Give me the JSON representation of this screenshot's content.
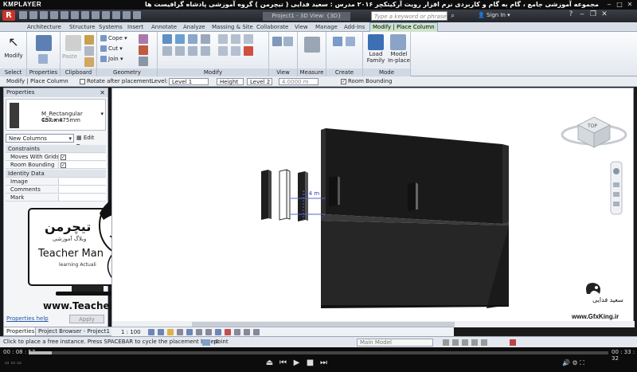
{
  "player": {
    "logo": "KMPLAYER",
    "title": "مجموعه آموزشی جامع ، گام به گام و کاربردی نرم افزار رویت آرکیتکچر ۲۰۱۶ مدرس : سعید فدایی ( تیچرمن ) گروه آموزشی پادشاه گرافیست ها",
    "time_current": "00 : 08 : 57",
    "time_total": "00 : 33 : 32",
    "progress": 0.04
  },
  "app": {
    "logo": "R",
    "doc_title": "Project1 - 3D View: {3D}",
    "search_placeholder": "Type a keyword or phrase",
    "sign_in": "Sign In"
  },
  "tabs": [
    "Architecture",
    "Structure",
    "Systems",
    "Insert",
    "Annotate",
    "Analyze",
    "Massing & Site",
    "Collaborate",
    "View",
    "Manage",
    "Add-Ins",
    "Modify | Place Column"
  ],
  "ribbon": {
    "modify": "Modify",
    "select_label": "Select",
    "properties_label": "Properties",
    "clipboard_label": "Clipboard",
    "paste": "Paste",
    "geometry_label": "Geometry",
    "cope": "Cope",
    "cut": "Cut",
    "join": "Join",
    "modify_label": "Modify",
    "view_label": "View",
    "measure_label": "Measure",
    "create_label": "Create",
    "mode_label": "Mode",
    "load_family": "Load Family",
    "model_inplace": "Model In-place"
  },
  "optbar": {
    "context": "Modify | Place Column",
    "rotate_after": "Rotate after placement",
    "level_label": "Level:",
    "level_value": "Level 1",
    "height_value": "Height",
    "height_level": "Level 2",
    "height_offset": "4.0000 m",
    "room_bounding": "Room Bounding"
  },
  "properties": {
    "header": "Properties",
    "type_name": "M_Rectangular Column",
    "type_dim": "457 x 475mm",
    "instance_selector": "New Columns",
    "edit_type": "Edit Type",
    "groups": [
      {
        "name": "Constraints",
        "rows": [
          "Moves With Grids",
          "Room Bounding"
        ]
      },
      {
        "name": "Identity Data",
        "rows": [
          "Image",
          "Comments",
          "Mark"
        ]
      }
    ],
    "help": "Properties help",
    "apply": "Apply",
    "tab_properties": "Properties",
    "tab_browser": "Project Browser - Project1"
  },
  "viewcube": {
    "face": "TOP"
  },
  "canvas": {
    "temp_dim": "2.4 m"
  },
  "view": {
    "scale": "1 : 100"
  },
  "status": {
    "text": "Click to place a free instance. Press SPACEBAR to cycle the placement basepoint",
    "model": "Main Model",
    "counter": ":0"
  },
  "watermark": {
    "logo_text": "تیچرمن",
    "logo_sub": "وبلاگ آموزشی",
    "brand": "Teacher Man",
    "brand_sub": "learning Actuali",
    "site": "www.TeacherMan.ir",
    "right_name": "سعید فدایی",
    "right_site": "www.GfxKing.ir"
  },
  "colors": {
    "accent": "#2a62b4",
    "ctx_tab": "#cfe3c9",
    "wall": "#303030"
  }
}
